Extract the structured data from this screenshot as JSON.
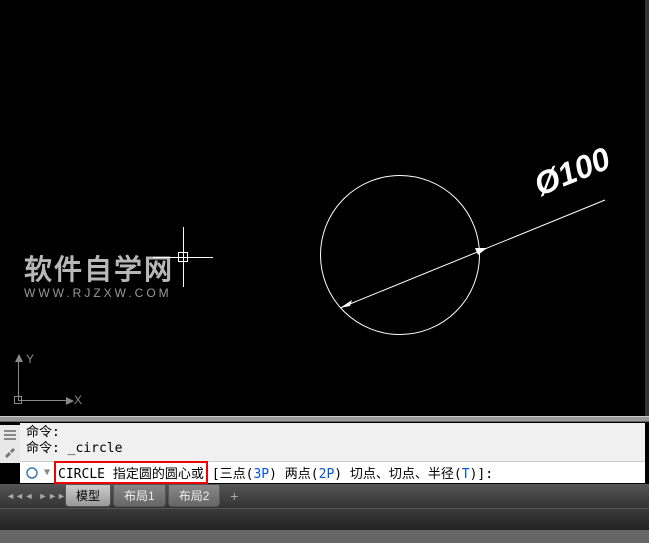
{
  "watermark": {
    "title": "软件自学网",
    "url": "WWW.RJZXW.COM"
  },
  "ucs": {
    "x_label": "X",
    "y_label": "Y"
  },
  "dimension": {
    "text": "Ø100"
  },
  "command_history": {
    "line1": "命令:",
    "line2": "命令: _circle"
  },
  "command_line": {
    "prompt": "CIRCLE 指定圆的圆心或",
    "tail_prefix": " [三点(",
    "opt1": "3P",
    "tail_mid1": ") 两点(",
    "opt2": "2P",
    "tail_mid2": ") 切点、切点、半径(",
    "opt3": "T",
    "tail_suffix": ")]:"
  },
  "tabs": {
    "model": "模型",
    "layout1": "布局1",
    "layout2": "布局2",
    "add": "+"
  },
  "chart_data": {
    "type": "diagram",
    "description": "CAD drawing canvas containing a circle with diameter dimension",
    "entities": [
      {
        "type": "circle",
        "diameter": 100
      },
      {
        "type": "diameter_dimension",
        "value": 100,
        "symbol": "Ø"
      }
    ]
  }
}
